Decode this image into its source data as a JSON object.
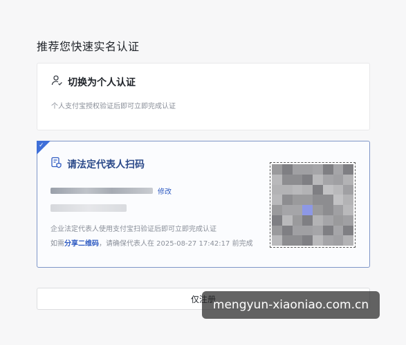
{
  "page": {
    "title": "推荐您快速实名认证"
  },
  "personal": {
    "title": "切换为个人认证",
    "desc": "个人支付宝授权验证后即可立即完成认证",
    "icon": "person-check-icon"
  },
  "legal": {
    "title": "请法定代表人扫码",
    "icon": "document-shield-icon",
    "edit": "修改",
    "desc1": "企业法定代表人使用支付宝扫验证后即可立即完成认证",
    "desc2_prefix": "如需",
    "share": "分享二维码",
    "desc2_suffix": "，请确保代表人在 2025-08-27 17:42:17 前完成",
    "selected": true
  },
  "register": {
    "label": "仅注册"
  },
  "watermark": {
    "text": "mengyun-xiaoniao.com.cn"
  },
  "colors": {
    "accent": "#3f6fd8",
    "link": "#2f5bc2",
    "title_blue": "#2c4a8a"
  }
}
